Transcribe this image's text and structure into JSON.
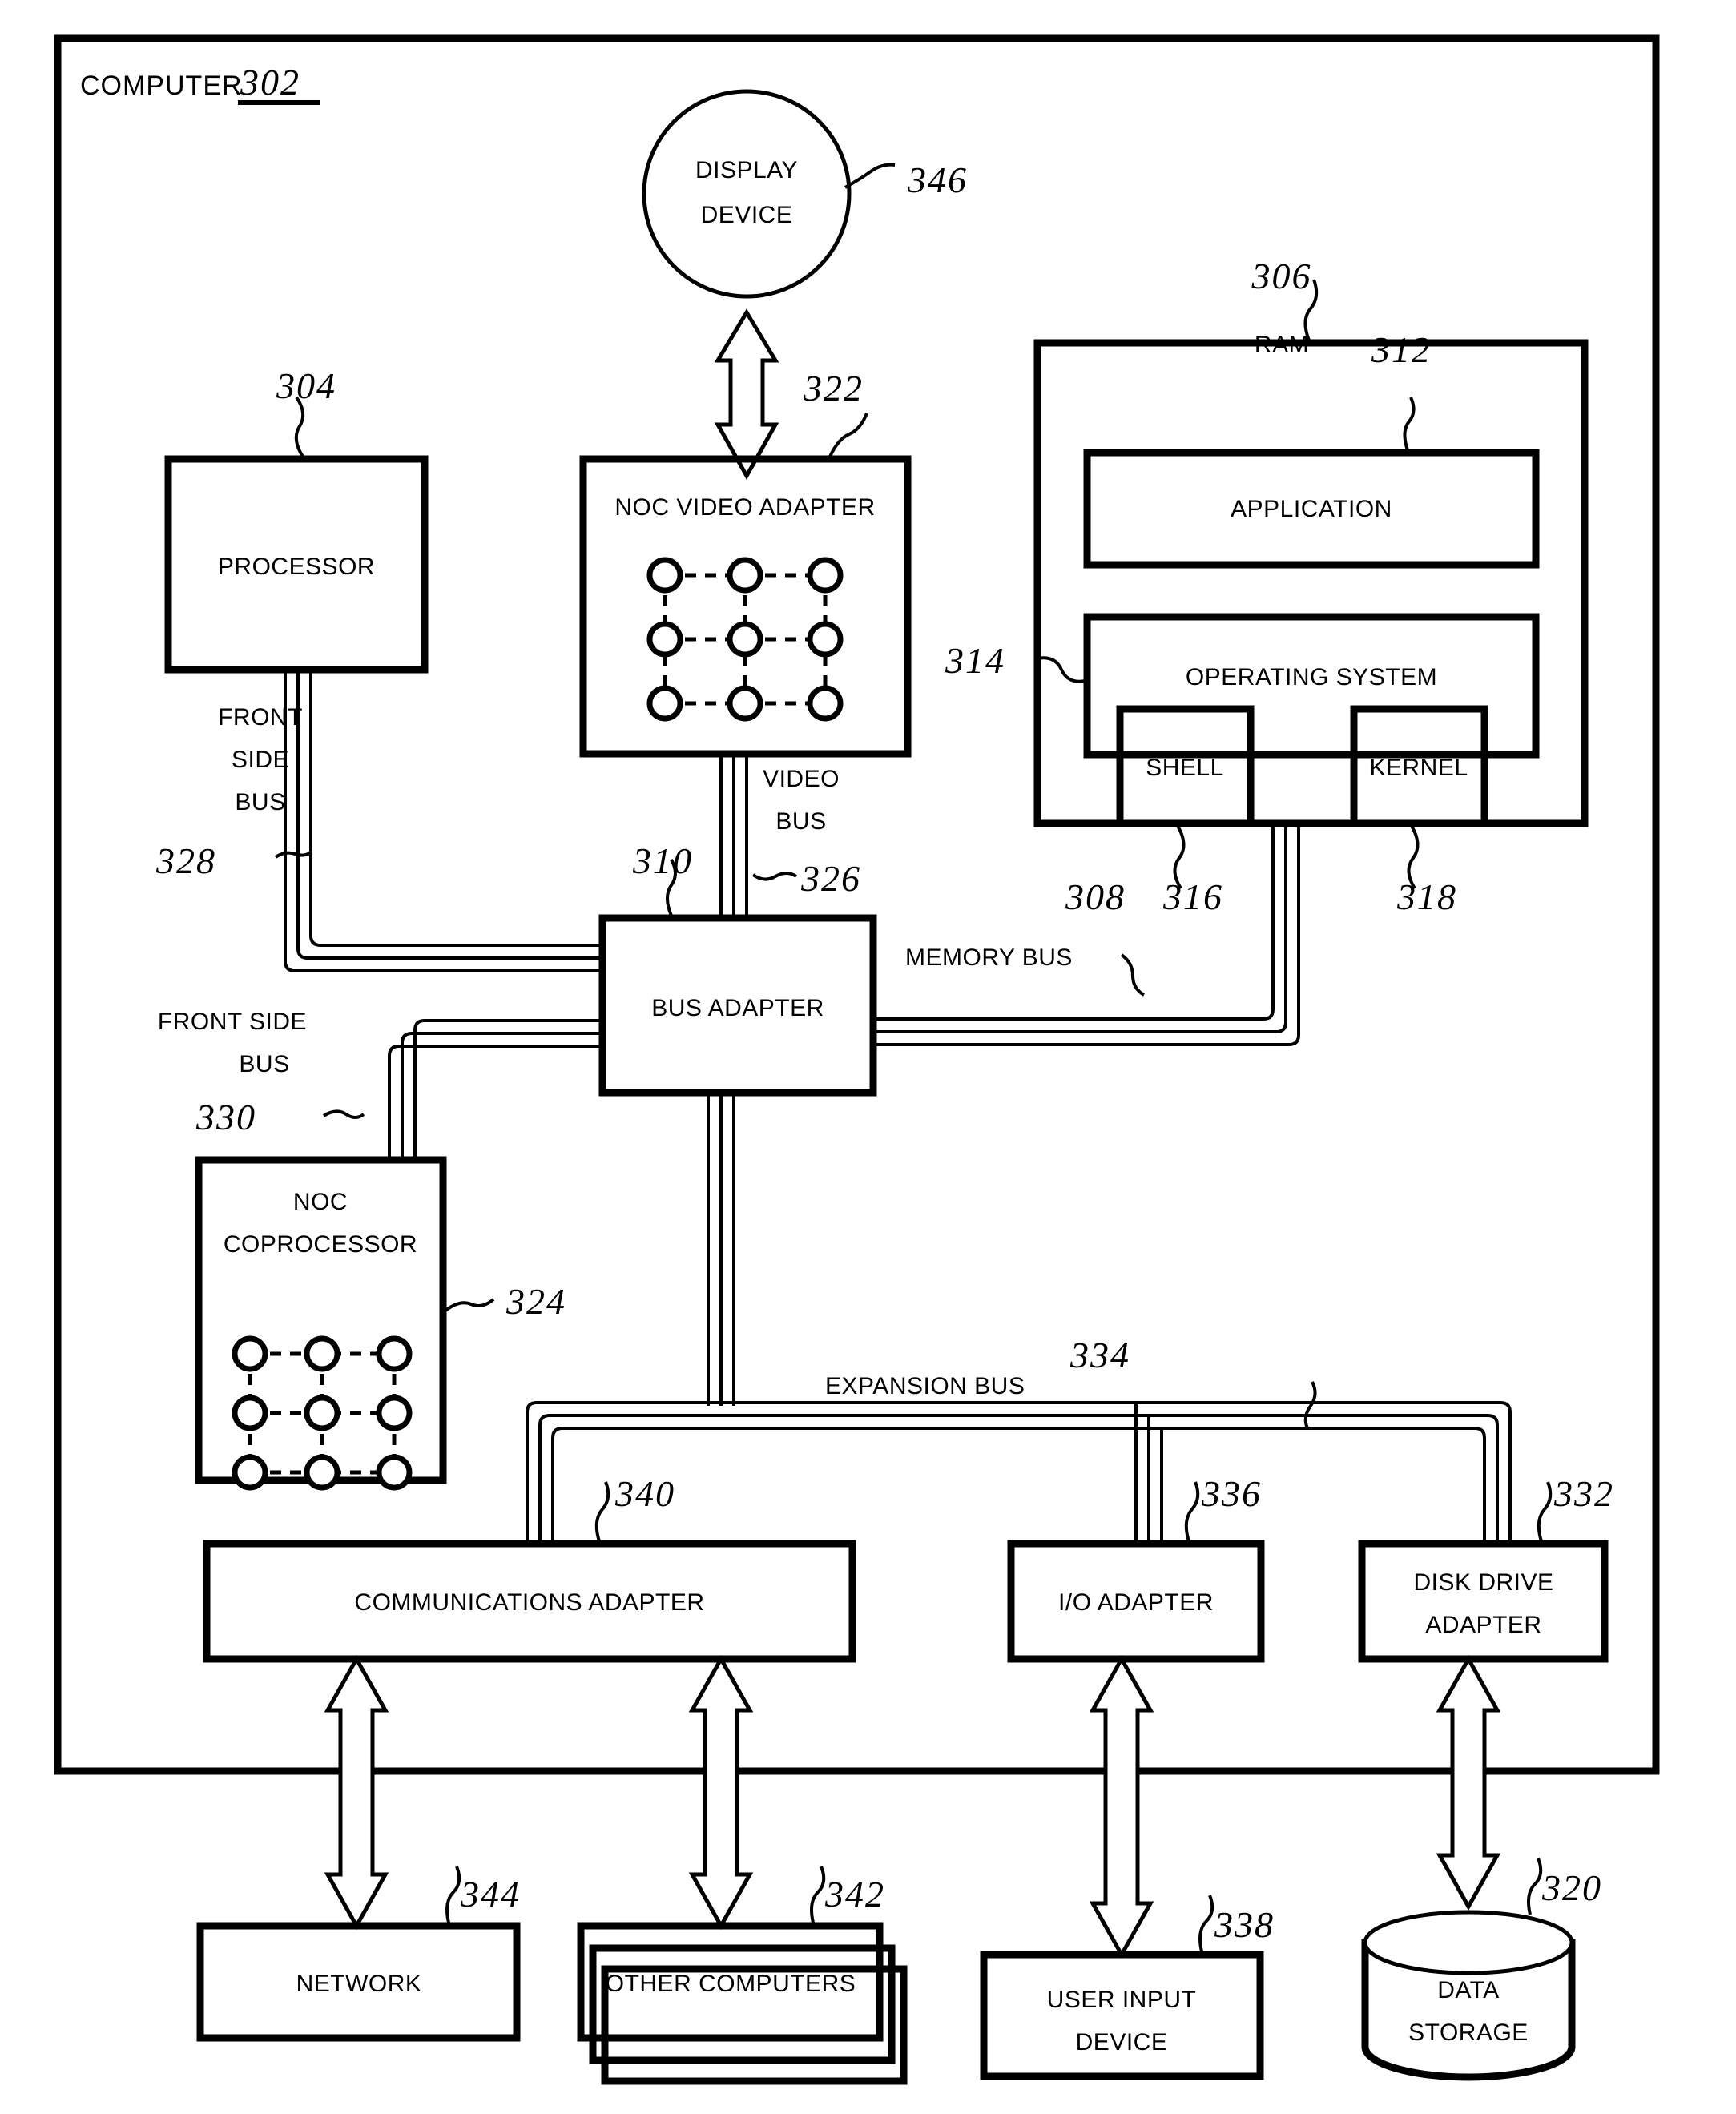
{
  "figure": {
    "title_label": "COMPUTER",
    "title_ref": "302"
  },
  "blocks": {
    "display_device": {
      "label_line1": "DISPLAY",
      "label_line2": "DEVICE",
      "ref": "346"
    },
    "processor": {
      "label": "PROCESSOR",
      "ref": "304"
    },
    "noc_video_adapter": {
      "label": "NOC VIDEO ADAPTER",
      "ref": "322"
    },
    "ram": {
      "label": "RAM",
      "ref_inline": "312",
      "ref": "306"
    },
    "application": {
      "label": "APPLICATION"
    },
    "operating_system": {
      "label": "OPERATING SYSTEM",
      "ref": "314"
    },
    "shell": {
      "label": "SHELL",
      "ref": "316"
    },
    "kernel": {
      "label": "KERNEL",
      "ref": "318"
    },
    "bus_adapter": {
      "label": "BUS ADAPTER",
      "ref": "310"
    },
    "noc_coprocessor": {
      "label_line1": "NOC",
      "label_line2": "COPROCESSOR",
      "ref": "324"
    },
    "communications_adapter": {
      "label": "COMMUNICATIONS ADAPTER",
      "ref": "340"
    },
    "io_adapter": {
      "label": "I/O ADAPTER",
      "ref": "336"
    },
    "disk_drive_adapter": {
      "label_line1": "DISK DRIVE",
      "label_line2": "ADAPTER",
      "ref": "332"
    },
    "network": {
      "label": "NETWORK",
      "ref": "344"
    },
    "other_computers": {
      "label": "OTHER COMPUTERS",
      "ref": "342"
    },
    "user_input_device": {
      "label_line1": "USER INPUT",
      "label_line2": "DEVICE",
      "ref": "338"
    },
    "data_storage": {
      "label_line1": "DATA",
      "label_line2": "STORAGE",
      "ref": "320"
    }
  },
  "buses": {
    "front_side_bus_processor": {
      "line1": "FRONT",
      "line2": "SIDE",
      "line3": "BUS",
      "ref": "328"
    },
    "front_side_bus_coprocessor": {
      "line1": "FRONT SIDE",
      "line2": "BUS",
      "ref": "330"
    },
    "video_bus": {
      "line1": "VIDEO",
      "line2": "BUS",
      "ref": "326"
    },
    "memory_bus": {
      "label": "MEMORY BUS",
      "ref": "308"
    },
    "expansion_bus": {
      "label": "EXPANSION BUS",
      "ref": "334"
    }
  },
  "mesh": {
    "rows": 3,
    "cols": 3,
    "node_count": 9
  },
  "colors": {
    "stroke": "#000000",
    "fill": "#ffffff"
  }
}
